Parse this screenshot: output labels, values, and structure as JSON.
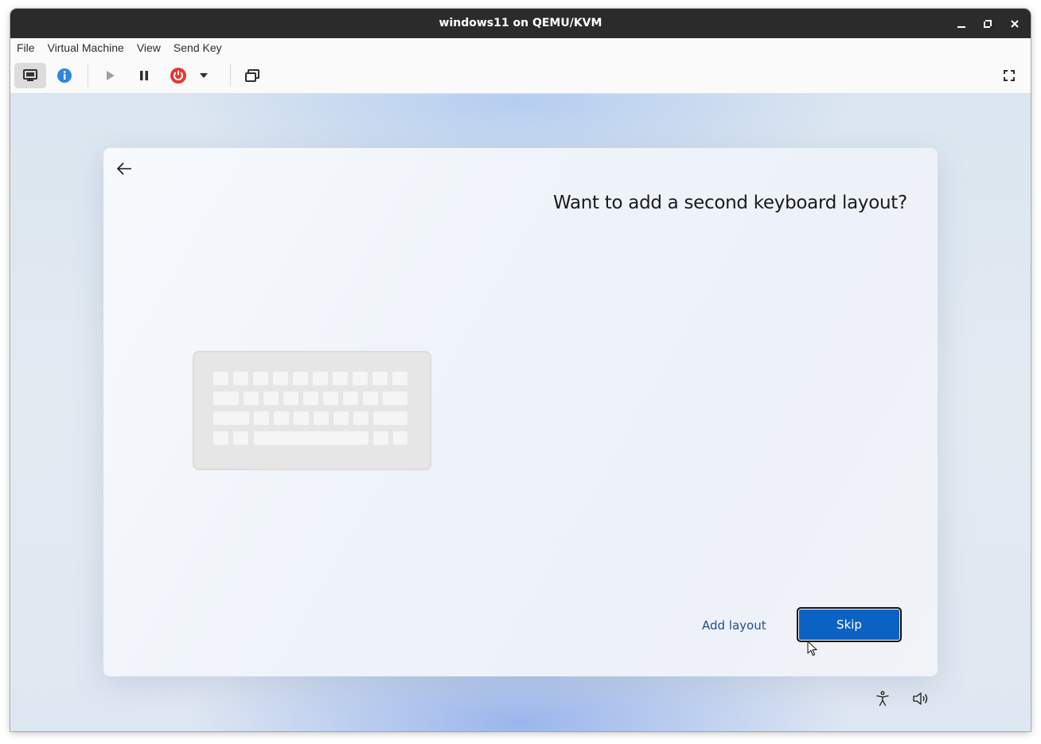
{
  "window": {
    "title": "windows11 on QEMU/KVM",
    "controls": [
      "minimize-icon",
      "restore-icon",
      "close-icon"
    ]
  },
  "menubar": {
    "items": [
      "File",
      "Virtual Machine",
      "View",
      "Send Key"
    ]
  },
  "toolbar": {
    "buttons": [
      "console-icon",
      "info-icon",
      "play-icon",
      "pause-icon",
      "power-icon",
      "dropdown-arrow-icon",
      "snapshots-icon",
      "fullscreen-icon"
    ],
    "colors": {
      "info": "#2e86de",
      "power": "#e53935"
    }
  },
  "oobe": {
    "title": "Want to add a second keyboard layout?",
    "add_layout_label": "Add layout",
    "skip_label": "Skip",
    "accent_color": "#0c62c2",
    "tray_icons": [
      "accessibility-icon",
      "volume-icon"
    ]
  }
}
